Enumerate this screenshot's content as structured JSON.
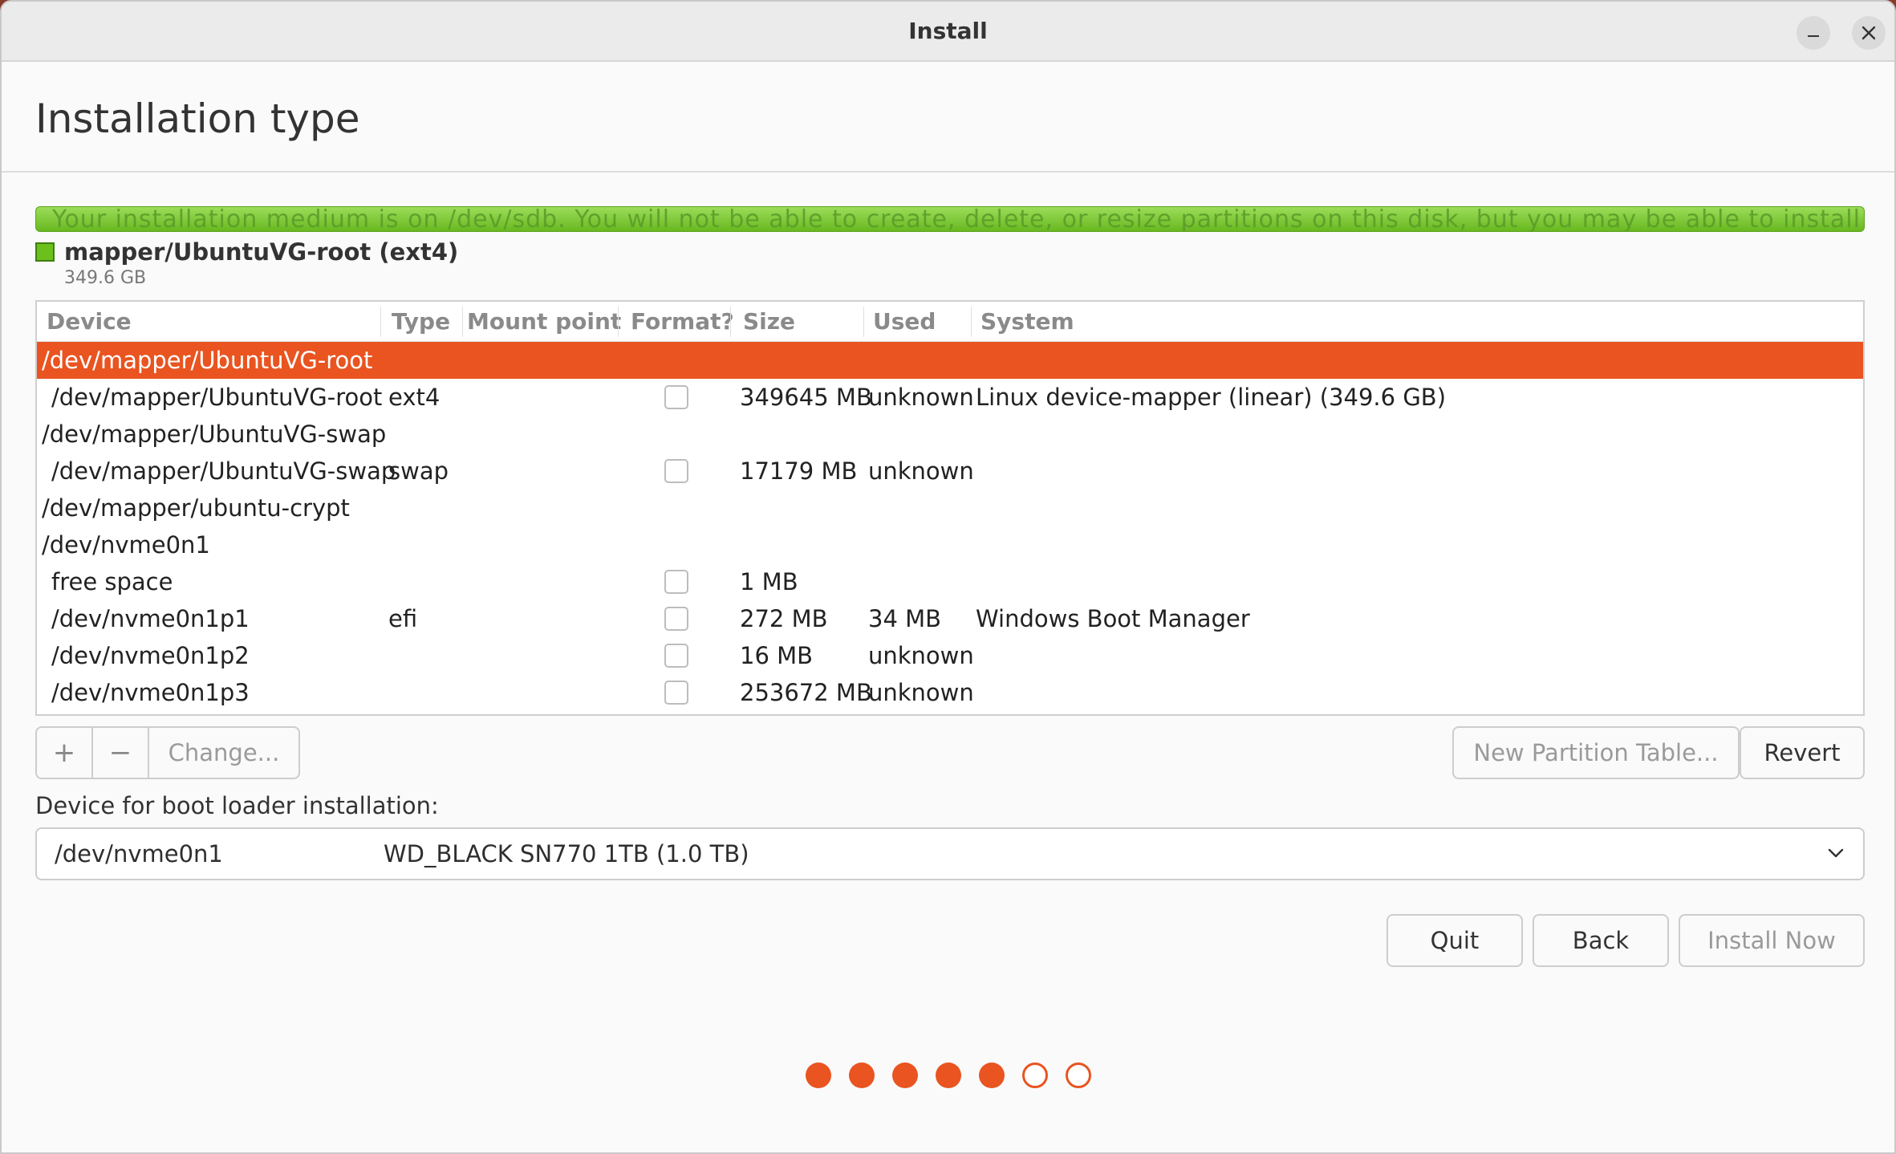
{
  "window": {
    "title": "Install"
  },
  "page": {
    "title": "Installation type"
  },
  "diskbar": {
    "overlay_text": "Your installation medium is on /dev/sdb. You will not be able to create, delete, or resize partitions on this disk, but you may be able to install to existing partitions there."
  },
  "legend": {
    "label": "mapper/UbuntuVG-root (ext4)",
    "size": "349.6 GB"
  },
  "table": {
    "columns": [
      "Device",
      "Type",
      "Mount point",
      "Format?",
      "Size",
      "Used",
      "System"
    ],
    "rows": [
      {
        "device": "/dev/mapper/UbuntuVG-root",
        "indent": false,
        "selected": true,
        "type": "",
        "mount": "",
        "format": null,
        "size": "",
        "used": "",
        "system": ""
      },
      {
        "device": "/dev/mapper/UbuntuVG-root",
        "indent": true,
        "selected": false,
        "type": "ext4",
        "mount": "",
        "format": false,
        "size": "349645 MB",
        "used": "unknown",
        "system": "Linux device-mapper (linear) (349.6 GB)"
      },
      {
        "device": "/dev/mapper/UbuntuVG-swap",
        "indent": false,
        "selected": false,
        "type": "",
        "mount": "",
        "format": null,
        "size": "",
        "used": "",
        "system": ""
      },
      {
        "device": "/dev/mapper/UbuntuVG-swap",
        "indent": true,
        "selected": false,
        "type": "swap",
        "mount": "",
        "format": false,
        "size": "17179 MB",
        "used": "unknown",
        "system": ""
      },
      {
        "device": "/dev/mapper/ubuntu-crypt",
        "indent": false,
        "selected": false,
        "type": "",
        "mount": "",
        "format": null,
        "size": "",
        "used": "",
        "system": ""
      },
      {
        "device": "/dev/nvme0n1",
        "indent": false,
        "selected": false,
        "type": "",
        "mount": "",
        "format": null,
        "size": "",
        "used": "",
        "system": ""
      },
      {
        "device": "free space",
        "indent": true,
        "selected": false,
        "type": "",
        "mount": "",
        "format": false,
        "size": "1 MB",
        "used": "",
        "system": ""
      },
      {
        "device": "/dev/nvme0n1p1",
        "indent": true,
        "selected": false,
        "type": "efi",
        "mount": "",
        "format": false,
        "size": "272 MB",
        "used": "34 MB",
        "system": "Windows Boot Manager"
      },
      {
        "device": "/dev/nvme0n1p2",
        "indent": true,
        "selected": false,
        "type": "",
        "mount": "",
        "format": false,
        "size": "16 MB",
        "used": "unknown",
        "system": ""
      },
      {
        "device": "/dev/nvme0n1p3",
        "indent": true,
        "selected": false,
        "type": "",
        "mount": "",
        "format": false,
        "size": "253672 MB",
        "used": "unknown",
        "system": ""
      }
    ]
  },
  "partition_buttons": {
    "add": "+",
    "remove": "−",
    "change": "Change..."
  },
  "table_buttons": {
    "new_table": "New Partition Table...",
    "revert": "Revert"
  },
  "bootloader": {
    "label": "Device for boot loader installation:",
    "device": "/dev/nvme0n1",
    "description": "WD_BLACK SN770 1TB (1.0 TB)"
  },
  "nav_buttons": {
    "quit": "Quit",
    "back": "Back",
    "install": "Install Now"
  },
  "progress": {
    "total_steps": 7,
    "completed_steps": 5
  },
  "colors": {
    "accent": "#E95420",
    "disk_bar": "#6BC01C"
  }
}
